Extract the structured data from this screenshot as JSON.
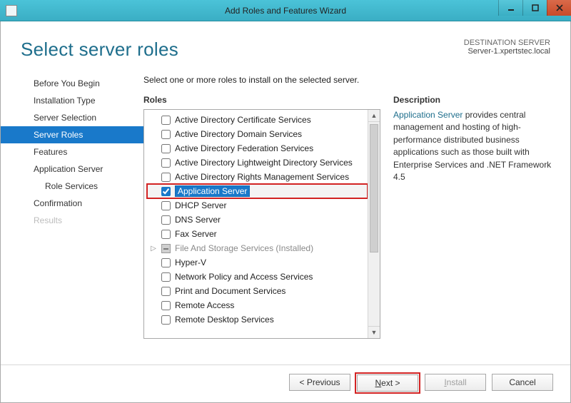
{
  "window": {
    "title": "Add Roles and Features Wizard"
  },
  "header": {
    "heading": "Select server roles",
    "destination_label": "DESTINATION SERVER",
    "destination_name": "Server-1.xpertstec.local"
  },
  "nav": {
    "items": [
      {
        "label": "Before You Begin",
        "active": false,
        "disabled": false,
        "sub": false
      },
      {
        "label": "Installation Type",
        "active": false,
        "disabled": false,
        "sub": false
      },
      {
        "label": "Server Selection",
        "active": false,
        "disabled": false,
        "sub": false
      },
      {
        "label": "Server Roles",
        "active": true,
        "disabled": false,
        "sub": false
      },
      {
        "label": "Features",
        "active": false,
        "disabled": false,
        "sub": false
      },
      {
        "label": "Application Server",
        "active": false,
        "disabled": false,
        "sub": false
      },
      {
        "label": "Role Services",
        "active": false,
        "disabled": false,
        "sub": true
      },
      {
        "label": "Confirmation",
        "active": false,
        "disabled": false,
        "sub": false
      },
      {
        "label": "Results",
        "active": false,
        "disabled": true,
        "sub": false
      }
    ]
  },
  "main": {
    "instruction": "Select one or more roles to install on the selected server.",
    "roles_label": "Roles",
    "description_label": "Description",
    "description_lead": "Application Server",
    "description_rest": " provides central management and hosting of high-performance distributed business applications such as those built with Enterprise Services and .NET Framework 4.5",
    "roles": [
      {
        "label": "Active Directory Certificate Services",
        "checked": false,
        "selected": false,
        "installed": false,
        "expandable": false
      },
      {
        "label": "Active Directory Domain Services",
        "checked": false,
        "selected": false,
        "installed": false,
        "expandable": false
      },
      {
        "label": "Active Directory Federation Services",
        "checked": false,
        "selected": false,
        "installed": false,
        "expandable": false
      },
      {
        "label": "Active Directory Lightweight Directory Services",
        "checked": false,
        "selected": false,
        "installed": false,
        "expandable": false
      },
      {
        "label": "Active Directory Rights Management Services",
        "checked": false,
        "selected": false,
        "installed": false,
        "expandable": false
      },
      {
        "label": "Application Server",
        "checked": true,
        "selected": true,
        "installed": false,
        "expandable": false,
        "highlight": true
      },
      {
        "label": "DHCP Server",
        "checked": false,
        "selected": false,
        "installed": false,
        "expandable": false
      },
      {
        "label": "DNS Server",
        "checked": false,
        "selected": false,
        "installed": false,
        "expandable": false
      },
      {
        "label": "Fax Server",
        "checked": false,
        "selected": false,
        "installed": false,
        "expandable": false
      },
      {
        "label": "File And Storage Services (Installed)",
        "checked": false,
        "selected": false,
        "installed": true,
        "expandable": true
      },
      {
        "label": "Hyper-V",
        "checked": false,
        "selected": false,
        "installed": false,
        "expandable": false
      },
      {
        "label": "Network Policy and Access Services",
        "checked": false,
        "selected": false,
        "installed": false,
        "expandable": false
      },
      {
        "label": "Print and Document Services",
        "checked": false,
        "selected": false,
        "installed": false,
        "expandable": false
      },
      {
        "label": "Remote Access",
        "checked": false,
        "selected": false,
        "installed": false,
        "expandable": false
      },
      {
        "label": "Remote Desktop Services",
        "checked": false,
        "selected": false,
        "installed": false,
        "expandable": false
      }
    ]
  },
  "footer": {
    "previous": "< Previous",
    "next_prefix": "N",
    "next_rest": "ext >",
    "install_prefix": "I",
    "install_rest": "nstall",
    "cancel": "Cancel"
  }
}
